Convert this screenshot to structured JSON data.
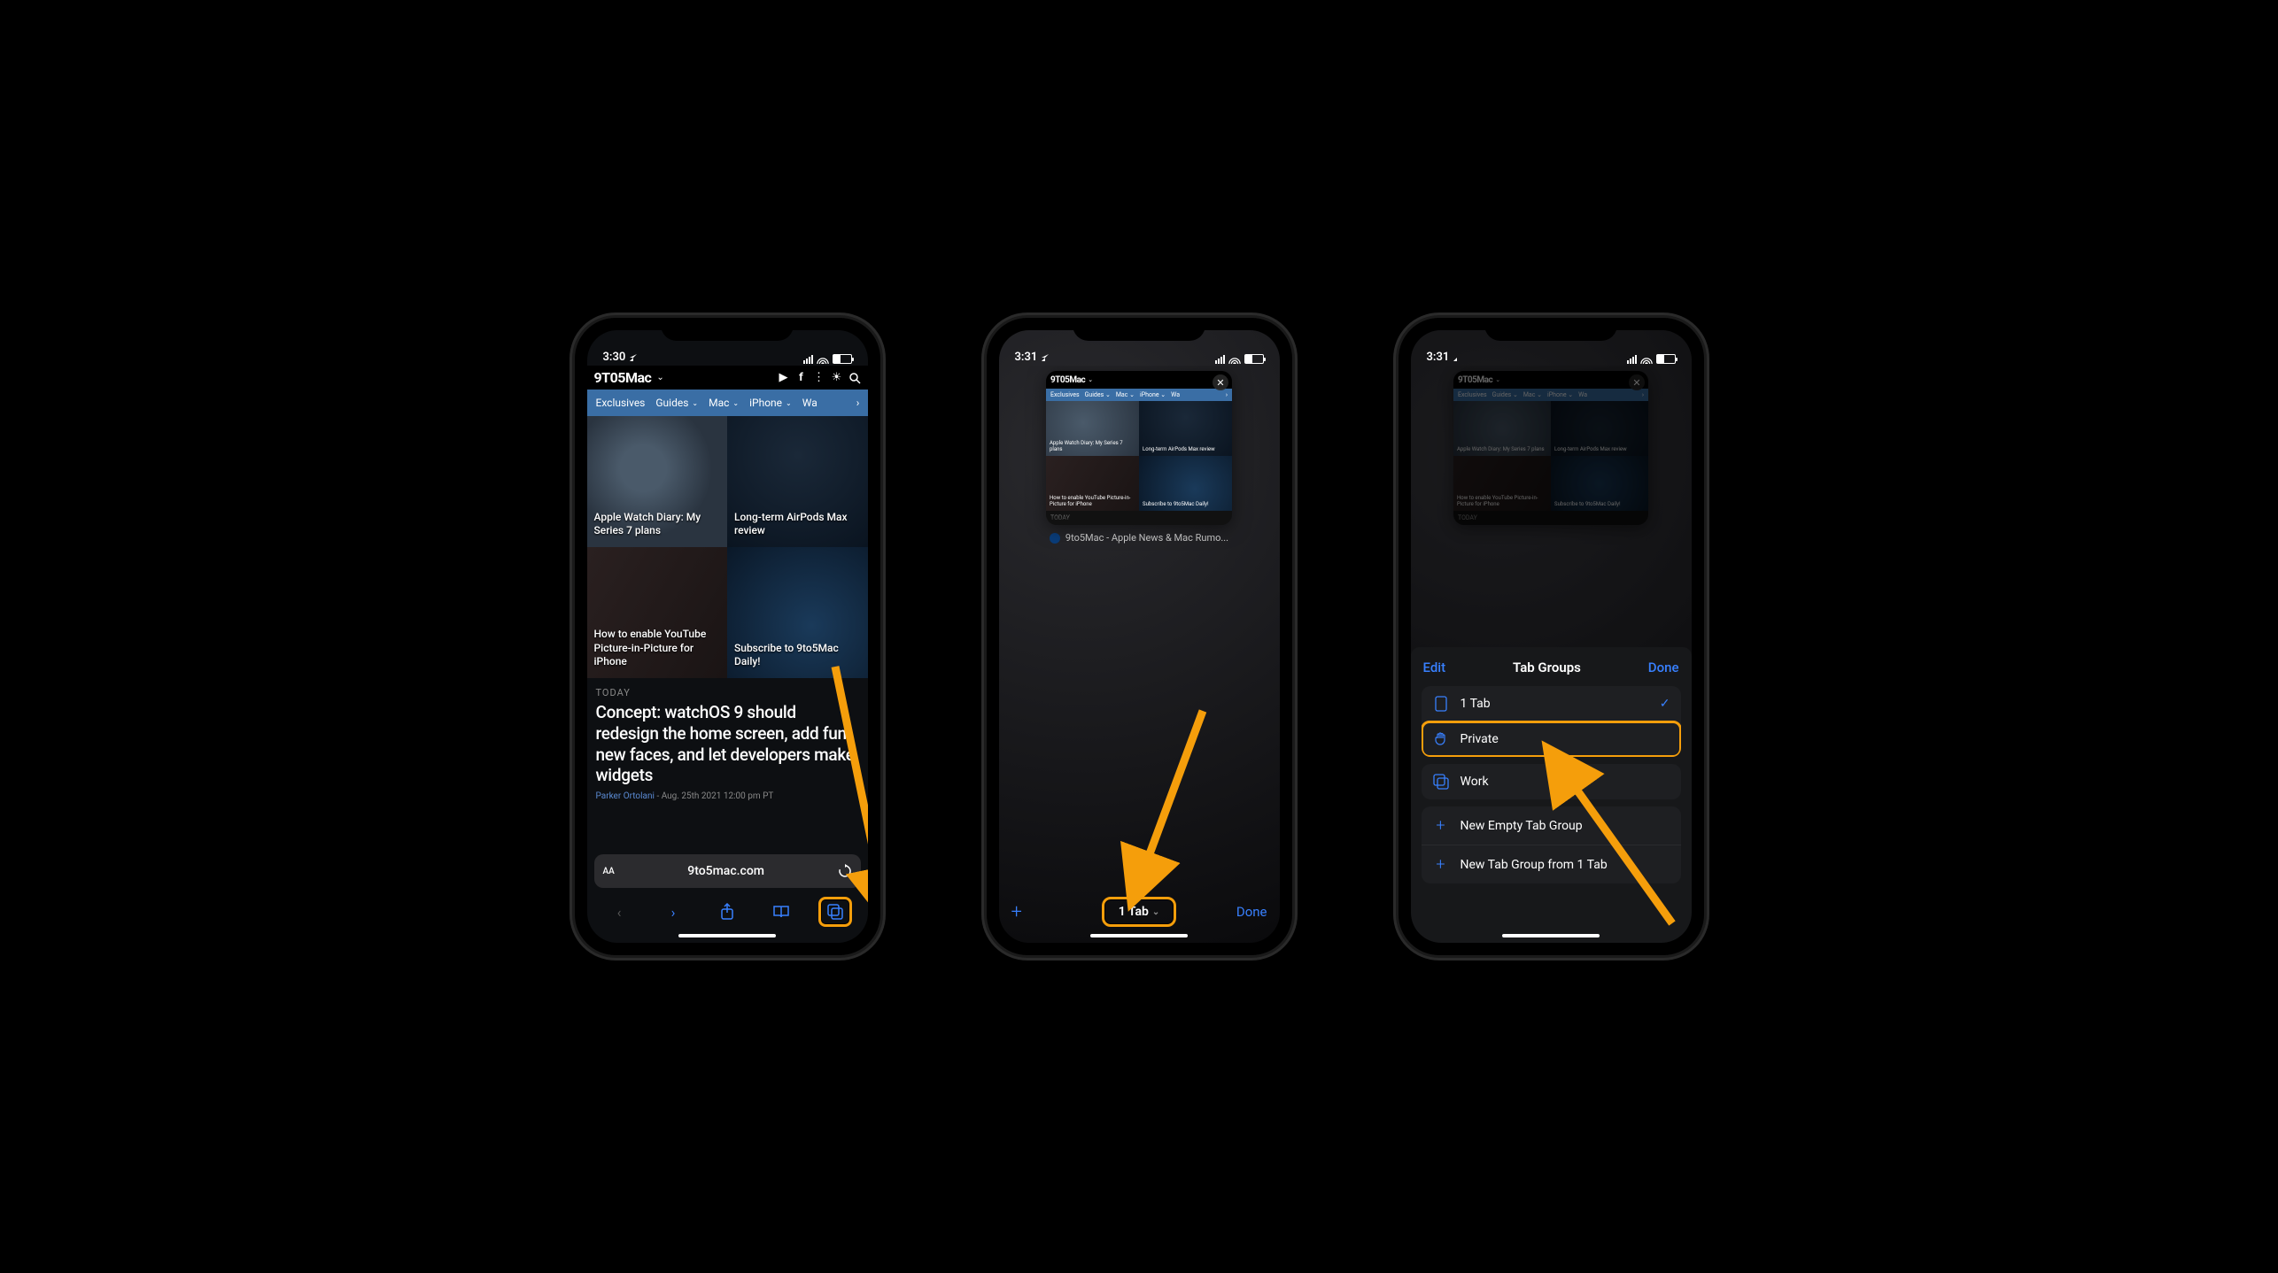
{
  "status1": {
    "time": "3:30"
  },
  "status2": {
    "time": "3:31"
  },
  "status3": {
    "time": "3:31"
  },
  "site": {
    "logo": "9T05Mac",
    "nav": [
      "Exclusives",
      "Guides",
      "Mac",
      "iPhone",
      "Wa"
    ]
  },
  "tiles": {
    "t1": "Apple Watch Diary: My Series 7 plans",
    "t2": "Long-term AirPods Max review",
    "t3": "How to enable YouTube Picture-in-Picture for iPhone",
    "t4": "Subscribe to 9to5Mac Daily!"
  },
  "section_today": "TODAY",
  "headline": "Concept: watchOS 9 should redesign the home screen, add fun new faces, and let developers make widgets",
  "author": "Parker Ortolani",
  "date": "Aug. 25th 2021 12:00 pm PT",
  "address": {
    "domain": "9to5mac.com"
  },
  "tabview": {
    "title": "9to5Mac - Apple News & Mac Rumo...",
    "count": "1 Tab",
    "done": "Done"
  },
  "panel": {
    "edit": "Edit",
    "title": "Tab Groups",
    "done": "Done",
    "row_tabs": "1 Tab",
    "row_private": "Private",
    "row_work": "Work",
    "row_new_empty": "New Empty Tab Group",
    "row_new_from": "New Tab Group from 1 Tab"
  }
}
